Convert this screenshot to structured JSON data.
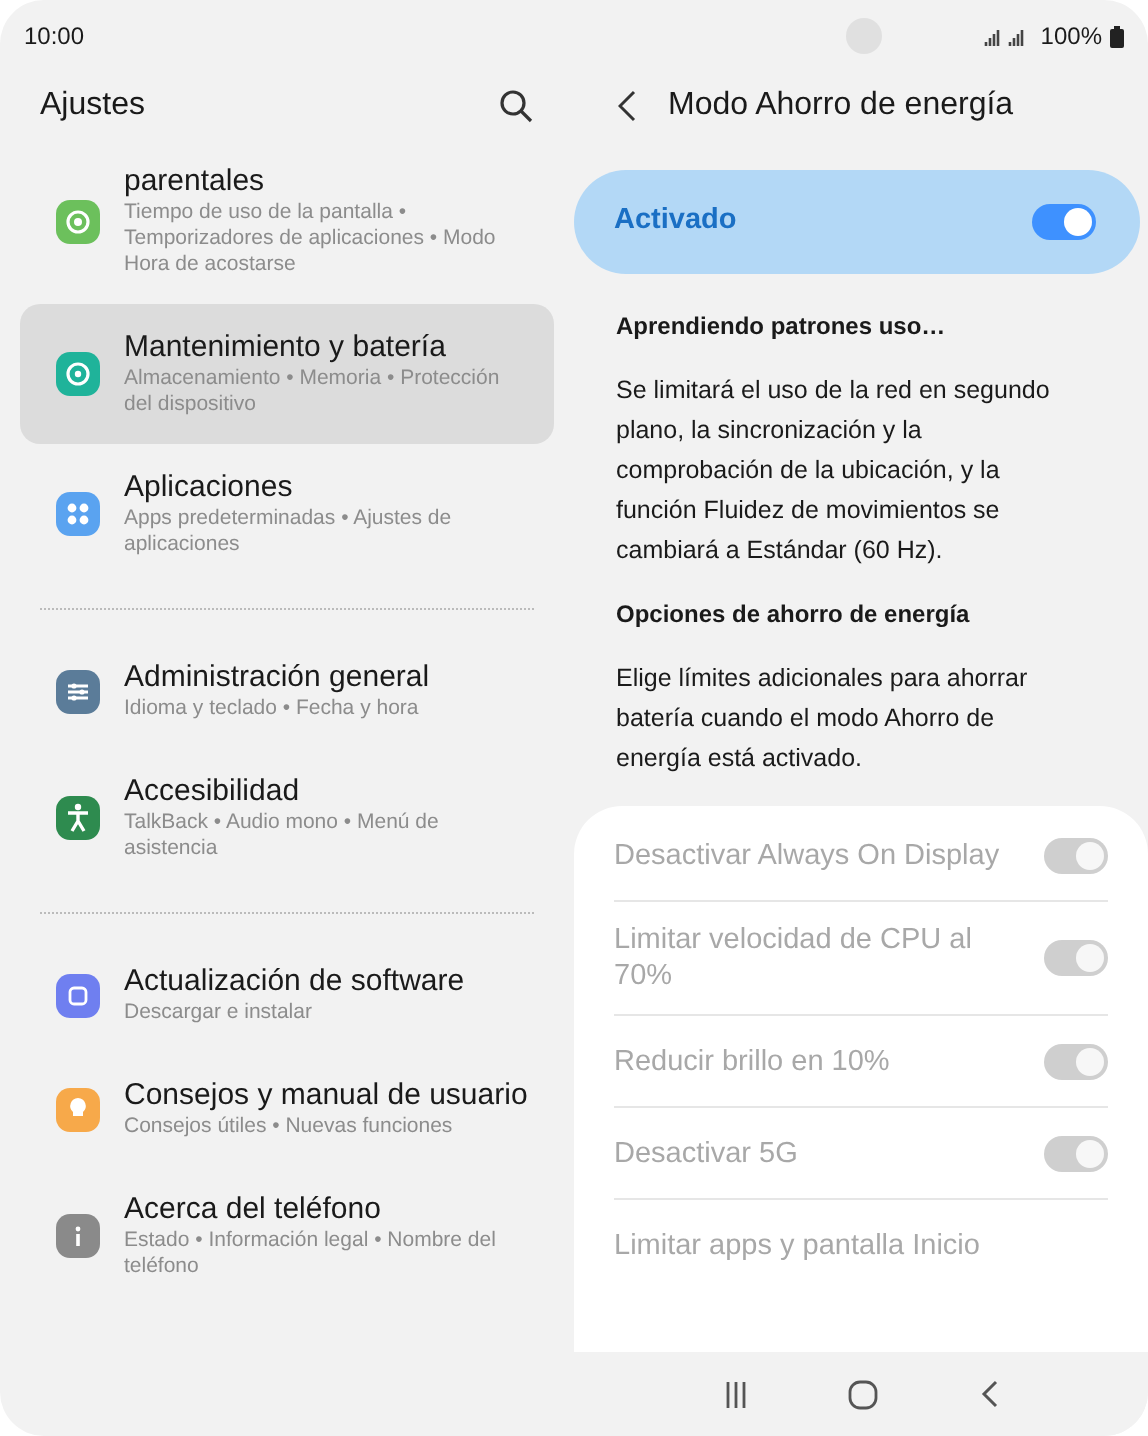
{
  "status_bar": {
    "time": "10:00",
    "battery": "100%"
  },
  "settings": {
    "title": "Ajustes",
    "groups": [
      {
        "items": [
          {
            "title": "parentales",
            "subtitle": "Tiempo de uso de la pantalla • Temporizadores de aplicaciones • Modo Hora de acostarse",
            "selected": false,
            "color": "#6cc05c"
          },
          {
            "title": "Mantenimiento y batería",
            "subtitle": "Almacenamiento • Memoria • Protección del dispositivo",
            "selected": true,
            "color": "#1fb39a"
          },
          {
            "title": "Aplicaciones",
            "subtitle": "Apps predeterminadas • Ajustes de aplicaciones",
            "selected": false,
            "color": "#5aa3f0"
          }
        ]
      },
      {
        "items": [
          {
            "title": "Administración general",
            "subtitle": "Idioma y teclado • Fecha y hora",
            "selected": false,
            "color": "#5b7c99"
          },
          {
            "title": "Accesibilidad",
            "subtitle": "TalkBack • Audio mono • Menú de asistencia",
            "selected": false,
            "color": "#2e8b4f"
          }
        ]
      },
      {
        "items": [
          {
            "title": "Actualización de software",
            "subtitle": "Descargar e instalar",
            "selected": false,
            "color": "#6f7ff0"
          },
          {
            "title": "Consejos y manual de usuario",
            "subtitle": "Consejos útiles • Nuevas funciones",
            "selected": false,
            "color": "#f7a94a"
          },
          {
            "title": "Acerca del teléfono",
            "subtitle": "Estado • Información legal • Nombre del teléfono",
            "selected": false,
            "color": "#8a8a8a"
          }
        ]
      }
    ]
  },
  "detail": {
    "title": "Modo Ahorro de energía",
    "master": {
      "label": "Activado",
      "on": true
    },
    "status_heading": "Aprendiendo patrones uso…",
    "description": "Se limitará el uso de la red en segundo plano, la sincronización y la comprobación de la ubicación, y la función Fluidez de movimientos se cambiará a Estándar (60 Hz).",
    "options_heading": "Opciones de ahorro de energía",
    "options_description": "Elige límites adicionales para ahorrar batería cuando el modo Ahorro de energía está activado.",
    "options": [
      {
        "label": "Desactivar Always On Display",
        "on": true,
        "disabled": true
      },
      {
        "label": "Limitar velocidad de CPU al 70%",
        "on": true,
        "disabled": true
      },
      {
        "label": "Reducir brillo en 10%",
        "on": true,
        "disabled": true
      },
      {
        "label": "Desactivar 5G",
        "on": true,
        "disabled": true
      },
      {
        "label": "Limitar apps y pantalla Inicio",
        "disabled": true
      }
    ]
  }
}
